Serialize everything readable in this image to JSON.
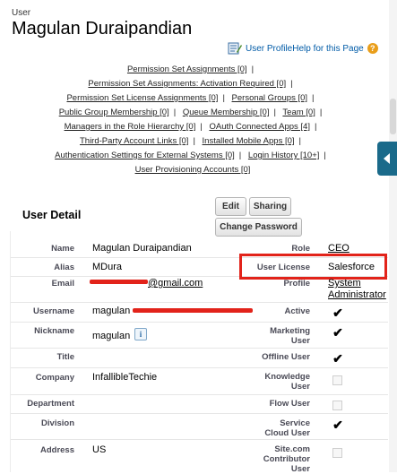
{
  "header": {
    "object_label": "User",
    "name": "Magulan Duraipandian",
    "help_link": "User ProfileHelp for this Page"
  },
  "related_links": [
    [
      "Permission Set Assignments [0]"
    ],
    [
      "Permission Set Assignments: Activation Required [0]"
    ],
    [
      "Permission Set License Assignments [0]",
      "Personal Groups [0]"
    ],
    [
      "Public Group Membership [0]",
      "Queue Membership [0]",
      "Team [0]"
    ],
    [
      "Managers in the Role Hierarchy [0]",
      "OAuth Connected Apps [4]"
    ],
    [
      "Third-Party Account Links [0]",
      "Installed Mobile Apps [0]"
    ],
    [
      "Authentication Settings for External Systems [0]",
      "Login History [10+]"
    ],
    [
      "User Provisioning Accounts [0]"
    ]
  ],
  "detail": {
    "title": "User Detail",
    "buttons": {
      "edit": "Edit",
      "sharing": "Sharing",
      "change_password": "Change Password"
    },
    "fields": {
      "name": {
        "label": "Name",
        "value": "Magulan Duraipandian"
      },
      "alias": {
        "label": "Alias",
        "value": "MDura"
      },
      "email": {
        "label": "Email",
        "value": "@gmail.com"
      },
      "username": {
        "label": "Username",
        "value": "magulan"
      },
      "nickname": {
        "label": "Nickname",
        "value": "magulan"
      },
      "title": {
        "label": "Title",
        "value": ""
      },
      "company": {
        "label": "Company",
        "value": "InfallibleTechie"
      },
      "department": {
        "label": "Department",
        "value": ""
      },
      "division": {
        "label": "Division",
        "value": ""
      },
      "address": {
        "label": "Address",
        "value": "US"
      },
      "role": {
        "label": "Role",
        "value": "CEO"
      },
      "user_license": {
        "label": "User License",
        "value": "Salesforce"
      },
      "profile": {
        "label": "Profile",
        "value_line1": "System",
        "value_line2": "Administrator"
      },
      "active": {
        "label": "Active",
        "checked": true
      },
      "marketing_user": {
        "label_line1": "Marketing",
        "label_line2": "User",
        "checked": true
      },
      "offline_user": {
        "label": "Offline User",
        "checked": true
      },
      "knowledge_user": {
        "label_line1": "Knowledge",
        "label_line2": "User",
        "checked": false
      },
      "flow_user": {
        "label": "Flow User",
        "checked": false
      },
      "service_cloud_user": {
        "label_line1": "Service",
        "label_line2": "Cloud User",
        "checked": true
      },
      "sitecom_contributor_user": {
        "label_line1": "Site.com",
        "label_line2": "Contributor",
        "label_line3": "User",
        "checked": false
      }
    },
    "info_icon_text": "i",
    "check_glyph": "✔"
  },
  "colors": {
    "link": "#015ba7",
    "highlight": "#e2231a",
    "side_tab": "#1a6a8a"
  },
  "icons": [
    "edit-note-icon",
    "help-question-icon",
    "info-icon",
    "checkmark-icon",
    "collapse-arrow-icon"
  ]
}
